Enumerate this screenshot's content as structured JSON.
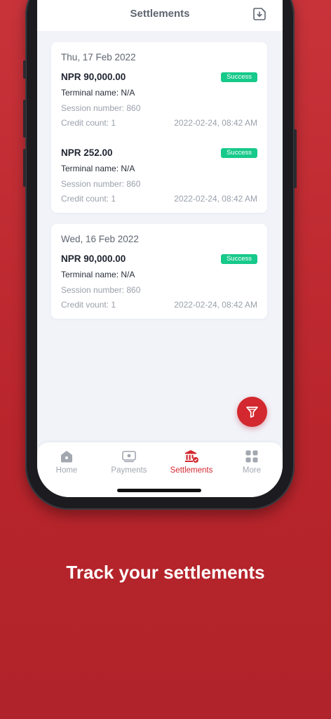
{
  "header": {
    "title": "Settlements",
    "export_icon": "export-download-icon"
  },
  "groups": [
    {
      "date": "Thu, 17 Feb 2022",
      "items": [
        {
          "amount": "NPR 90,000.00",
          "status": "Success",
          "terminal": "Terminal name: N/A",
          "session": "Session number: 860",
          "count": "Credit count: 1",
          "timestamp": "2022-02-24, 08:42 AM"
        },
        {
          "amount": "NPR 252.00",
          "status": "Success",
          "terminal": "Terminal name: N/A",
          "session": "Session number: 860",
          "count": "Credit count: 1",
          "timestamp": "2022-02-24, 08:42 AM"
        }
      ]
    },
    {
      "date": "Wed, 16 Feb 2022",
      "items": [
        {
          "amount": "NPR 90,000.00",
          "status": "Success",
          "terminal": "Terminal name: N/A",
          "session": "Session number: 860",
          "count": "Credit vount: 1",
          "timestamp": "2022-02-24, 08:42 AM"
        }
      ]
    }
  ],
  "fab": {
    "icon": "filter-icon"
  },
  "tabs": [
    {
      "label": "Home",
      "icon": "home-icon"
    },
    {
      "label": "Payments",
      "icon": "payments-icon"
    },
    {
      "label": "Settlements",
      "icon": "bank-icon",
      "active": true
    },
    {
      "label": "More",
      "icon": "grid-icon"
    }
  ],
  "tagline": "Track your settlements",
  "colors": {
    "brand_red": "#d3282f",
    "success_green": "#17c98a",
    "background_red": "#c12c33"
  }
}
